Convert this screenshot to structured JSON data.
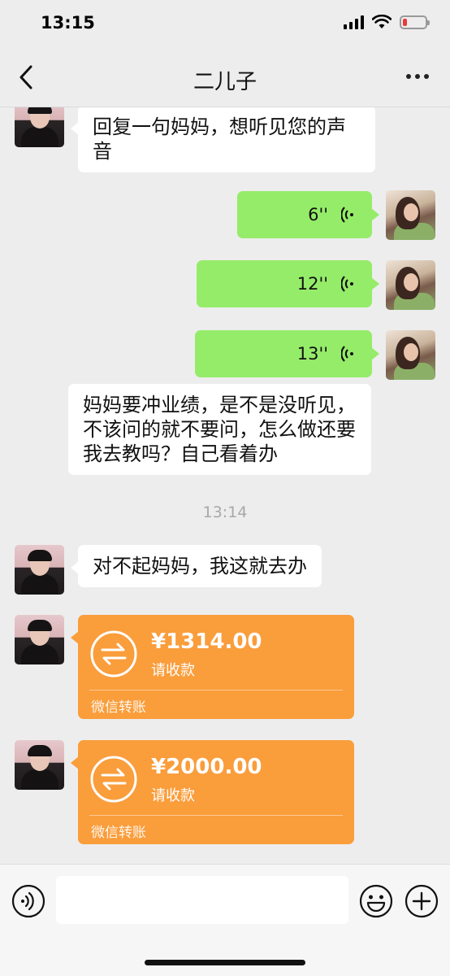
{
  "status_bar": {
    "time": "13:15",
    "battery_level": 0.2,
    "battery_color": "#e93a3a"
  },
  "nav": {
    "title": "二儿子",
    "back_icon": "chevron-left-icon",
    "more_icon": "ellipsis-icon"
  },
  "messages": [
    {
      "sender": "contact",
      "type": "text",
      "text": "回复一句妈妈，想听见您的声音"
    },
    {
      "sender": "me",
      "type": "voice",
      "duration": "6''"
    },
    {
      "sender": "me",
      "type": "voice",
      "duration": "12''"
    },
    {
      "sender": "me",
      "type": "voice",
      "duration": "13''"
    },
    {
      "sender": "me",
      "type": "text",
      "text": "妈妈要冲业绩，是不是没听见，不该问的就不要问，怎么做还要我去教吗？自己看着办"
    },
    {
      "type": "timestamp",
      "text": "13:14"
    },
    {
      "sender": "contact",
      "type": "text",
      "text": "对不起妈妈，我这就去办"
    },
    {
      "sender": "contact",
      "type": "transfer",
      "amount": "¥1314.00",
      "status": "请收款",
      "footer": "微信转账"
    },
    {
      "sender": "contact",
      "type": "transfer",
      "amount": "¥2000.00",
      "status": "请收款",
      "footer": "微信转账"
    }
  ],
  "colors": {
    "my_bubble": "#95ec69",
    "transfer": "#fa9d3b",
    "background": "#ededed"
  },
  "input_bar": {
    "voice_icon": "voice-input-icon",
    "emoji_icon": "emoji-icon",
    "plus_icon": "plus-icon",
    "value": ""
  }
}
